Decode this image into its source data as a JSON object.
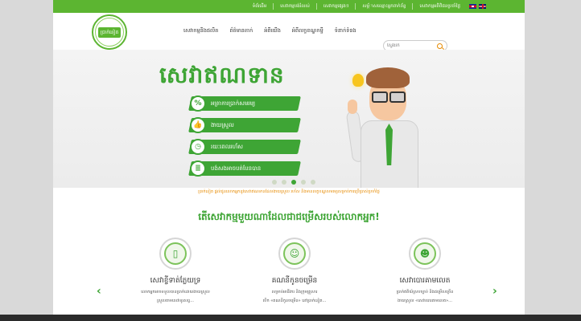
{
  "topbar": {
    "links": [
      "ទំព័រដើម",
      "សេវាកម្មបង់រំលស់",
      "សេវាកម្មផ្សេងៗ",
      "សម័្ភាសឈ្មោះអ្នកពាក់ព័ន្ធ",
      "សេវាកម្មអតិថិជនប្រចាំថ្ងៃ"
    ],
    "lang_kh": "km-flag-icon",
    "lang_en": "uk-flag-icon"
  },
  "header": {
    "logo_text": "ប្រាក់នៀត",
    "nav": [
      "សេវាកម្មនិងផលិត",
      "ព័ត៌មានតាក់",
      "អំពីយើង",
      "អំពីលក្ខខណ្ឌកម្ចី",
      "ទំនាក់ទំនង"
    ],
    "search_placeholder": "ស្វែងរក"
  },
  "banner": {
    "title": "សេវាឥណទាន",
    "features": [
      {
        "icon": "%",
        "label": "អត្រាការប្រាក់សមរម្យ"
      },
      {
        "icon": "👍",
        "label": "ងាយស្រួល"
      },
      {
        "icon": "◷",
        "label": "រយៈពេលរហ័ស"
      },
      {
        "icon": "≣",
        "label": "បង់សងអាចបត់បែនបាន"
      }
    ],
    "caption": "ប្រាក់នៀត ផ្តល់ជូនលោកអ្នកនូវសេវាឥណទានដែលងាយស្រួល រហ័ស និងមានលក្ខខណ្ឌសមរម្យសម្រាប់ការប្រើប្រាស់ប្រចាំថ្ងៃ",
    "slide_count": 5,
    "active_slide": 3
  },
  "services": {
    "title": "តើសេវាកម្មមួយណាដែលជាជម្រើសរបស់លោកអ្នក!",
    "items": [
      {
        "icon": "phone-icon",
        "symbol": "▯",
        "title": "សេវាខ្ចីទាត់ភ្លែយទ្រ",
        "desc1": "លោកអ្នកអាចទទួលបានប្រាក់ដោយងាយស្រួល",
        "desc2": "ស្រួលតាមសេវាទូរសព្ទ..."
      },
      {
        "icon": "group-icon",
        "symbol": "☺",
        "title": "គណនីកូនចម្រើន",
        "desc1": "សម្រាប់អាជីវករ និងក្រុមគ្រួសារ",
        "desc2": "បើក «គណនីកូនចម្រើន» នៅប្រាក់នៀត..."
      },
      {
        "icon": "team-icon",
        "symbol": "☻",
        "title": "សេវាបោរគាមលេត",
        "desc1": "ប្រាក់ឥតិយ៍ស្របច្បាប់ និងជម្រើសច្រើន",
        "desc2": "ងាយស្រួល «សេវាបោរគាមលេត»..."
      }
    ]
  },
  "carousel": {
    "prev": "‹",
    "next": "›"
  }
}
